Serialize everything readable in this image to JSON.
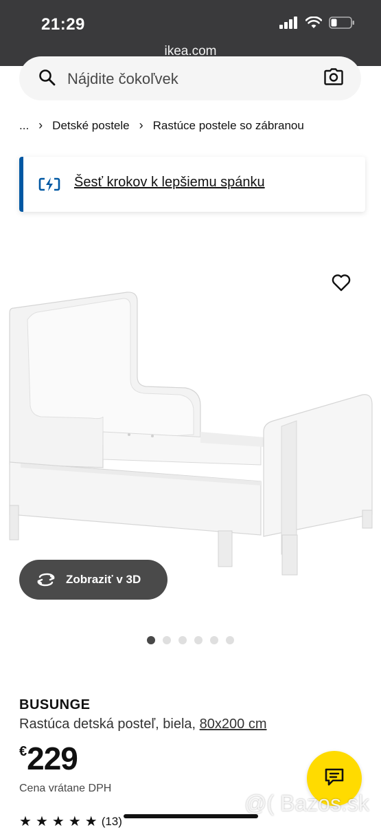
{
  "status": {
    "time": "21:29",
    "url": "ikea.com"
  },
  "search": {
    "placeholder": "Nájdite čokoľvek"
  },
  "breadcrumb": {
    "ellipsis": "...",
    "items": [
      "Detské postele",
      "Rastúce postele so zábranou"
    ]
  },
  "banner": {
    "link": "Šesť krokov k lepšiemu spánku"
  },
  "gallery": {
    "view3d_label": "Zobraziť v 3D",
    "dots_count": 6,
    "active_index": 0
  },
  "product": {
    "name": "BUSUNGE",
    "description": "Rastúca detská posteľ, biela, ",
    "size": "80x200 cm",
    "currency": "€",
    "price": "229",
    "price_note": "Cena vrátane DPH",
    "rating_count": "(13)",
    "rating_stars": 5
  },
  "watermark": "@( Bazos.sk",
  "colors": {
    "accent_yellow": "#ffdb00",
    "brand_blue": "#0058a3",
    "statusbar": "#3a3a3c"
  },
  "icons": [
    "search-icon",
    "camera-icon",
    "chevron-right-icon",
    "spark-icon",
    "heart-icon",
    "rotate-3d-icon",
    "chat-icon",
    "star-icon",
    "wifi-icon",
    "signal-icon",
    "battery-icon"
  ]
}
